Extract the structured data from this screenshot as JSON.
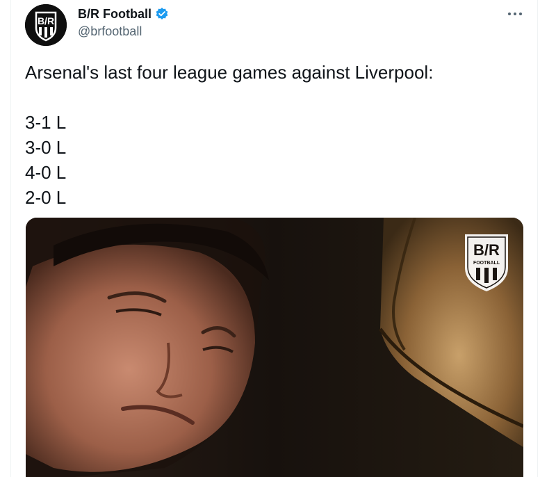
{
  "tweet": {
    "author": {
      "display_name": "B/R Football",
      "handle": "@brfootball",
      "verified": true,
      "avatar_icon": "br-logo-icon"
    },
    "more_icon": "more-options-icon",
    "text_lines": [
      "Arsenal's last four league games against Liverpool:",
      "",
      "3-1 L",
      "3-0 L",
      "4-0 L",
      "2-0 L"
    ],
    "media": {
      "watermark_text": "B/R",
      "watermark_subtext": "FOOTBALL"
    }
  },
  "colors": {
    "text_primary": "#0f1419",
    "text_secondary": "#536471",
    "verified_blue": "#1d9bf0",
    "border": "#eff3f4"
  }
}
